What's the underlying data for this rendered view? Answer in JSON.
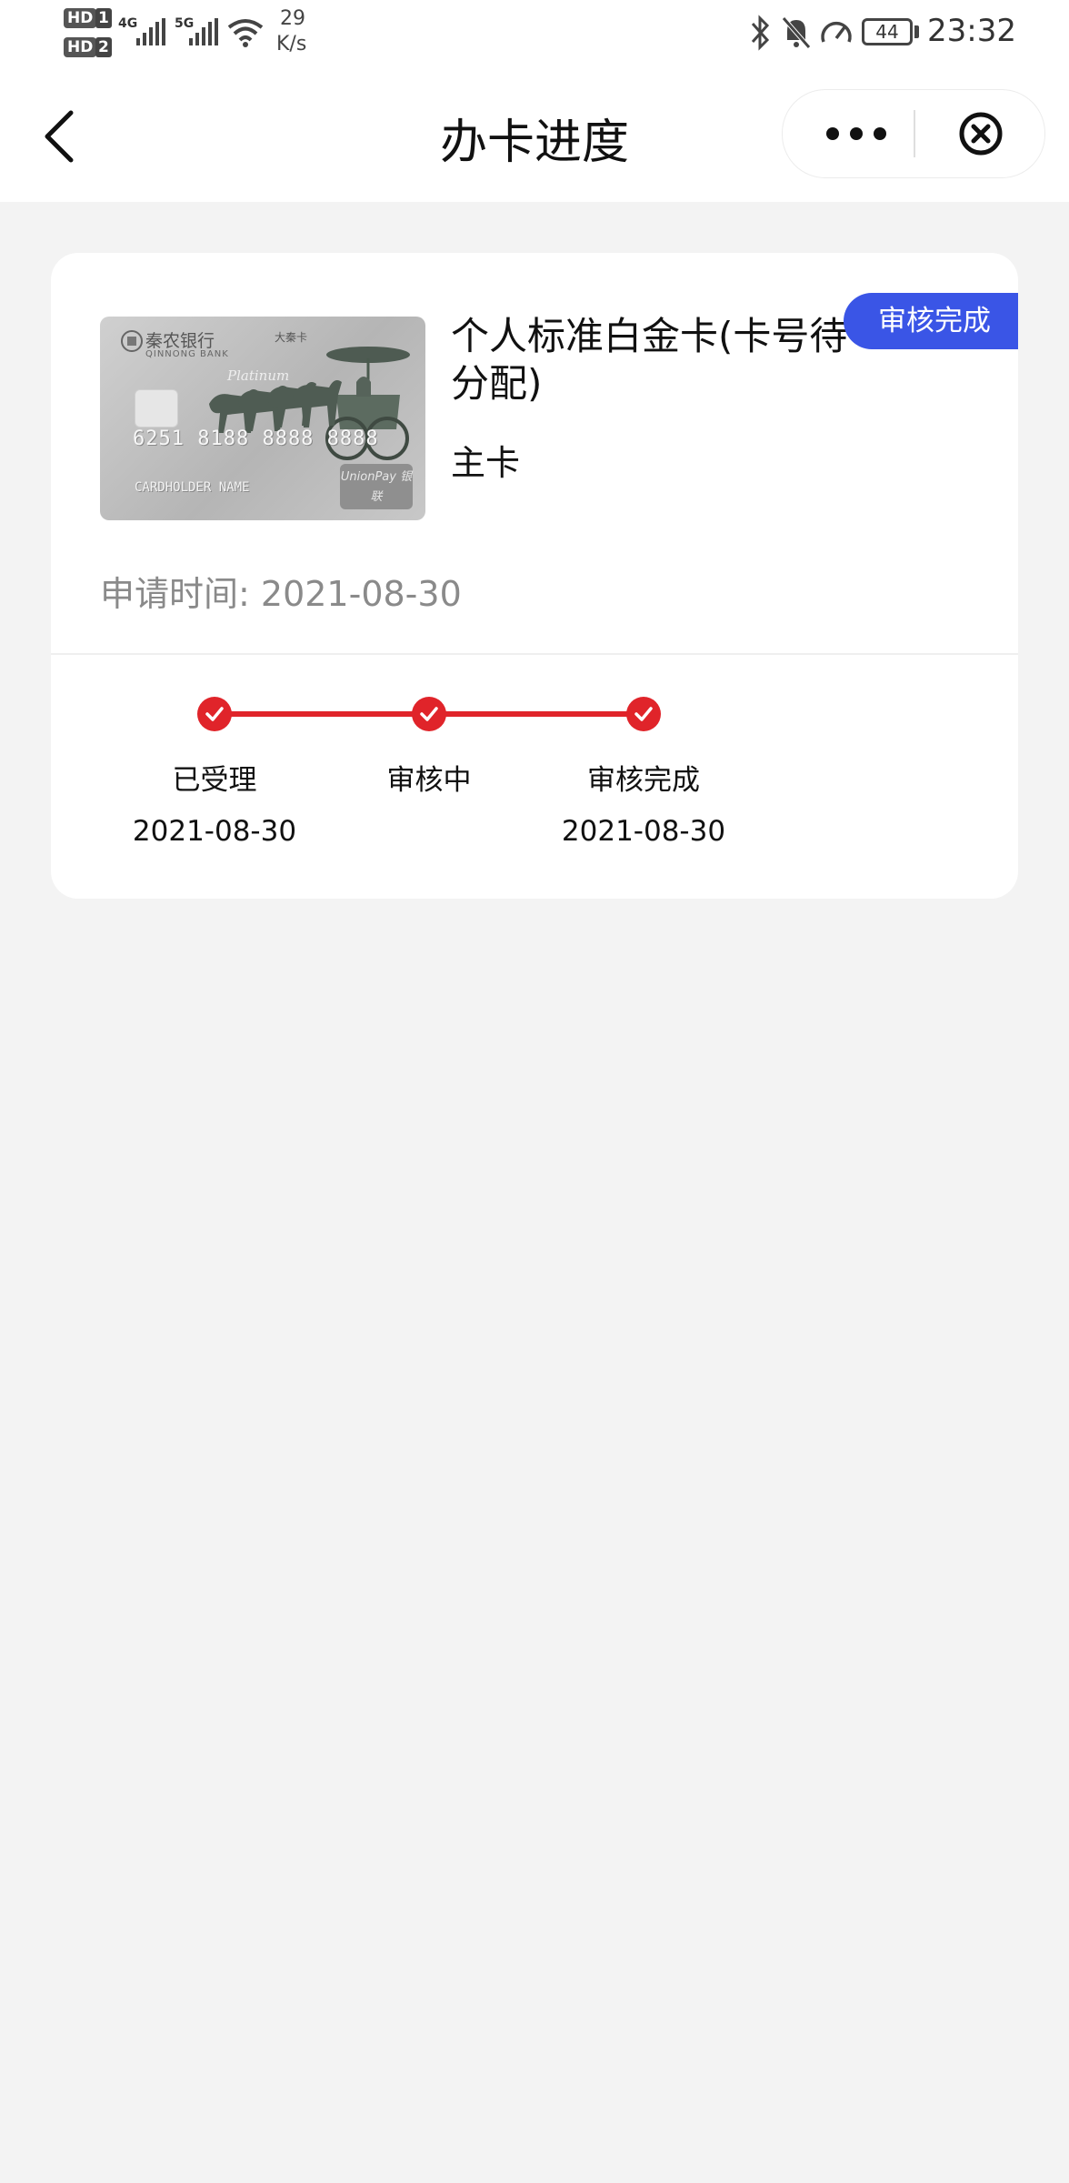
{
  "status_bar": {
    "hd1": "HD",
    "hd1_num": "1",
    "hd2": "HD",
    "hd2_num": "2",
    "net1": "4G",
    "net2": "5G",
    "speed": "29",
    "speed_unit": "K/s",
    "battery": "44",
    "time": "23:32"
  },
  "nav": {
    "title": "办卡进度",
    "back_icon": "chevron-left-icon",
    "more_icon": "more-dots-icon",
    "close_icon": "close-circle-icon"
  },
  "card": {
    "image": {
      "bank_name": "秦农银行",
      "bank_en": "QINNONG BANK",
      "series": "大秦卡",
      "tier": "Platinum",
      "number": "6251 8188 8888 8888",
      "holder": "CARDHOLDER NAME",
      "network": "UnionPay 银联"
    },
    "name": "个人标准白金卡(卡号待分配)",
    "type": "主卡",
    "status_badge": "审核完成",
    "apply_time_label": "申请时间:",
    "apply_time_value": "2021-08-30",
    "accent_color": "#3a55e6",
    "progress_color": "#e0242a"
  },
  "steps": [
    {
      "label": "已受理",
      "date": "2021-08-30",
      "done": true
    },
    {
      "label": "审核中",
      "date": "",
      "done": true
    },
    {
      "label": "审核完成",
      "date": "2021-08-30",
      "done": true
    }
  ]
}
